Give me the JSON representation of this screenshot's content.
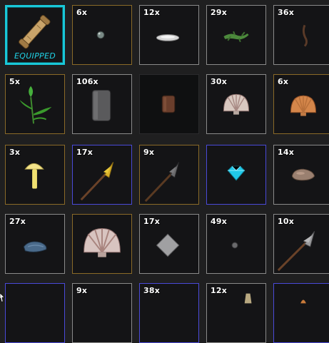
{
  "inventory": {
    "equipped_label": "EQUIPPED",
    "slots": [
      {
        "name": "scroll",
        "count": "",
        "equipped": true
      },
      {
        "name": "pearl",
        "count": "6x"
      },
      {
        "name": "silver-disc",
        "count": "12x"
      },
      {
        "name": "green-lizard",
        "count": "29x"
      },
      {
        "name": "twig",
        "count": "36x"
      },
      {
        "name": "green-plant",
        "count": "5x"
      },
      {
        "name": "grey-canister",
        "count": "106x"
      },
      {
        "name": "copper-canister",
        "count": ""
      },
      {
        "name": "scallop-shell-white",
        "count": "30x"
      },
      {
        "name": "scallop-shell-orange",
        "count": "6x"
      },
      {
        "name": "yellow-mushroom",
        "count": "3x"
      },
      {
        "name": "golden-spear",
        "count": "17x"
      },
      {
        "name": "iron-spear",
        "count": "9x"
      },
      {
        "name": "cyan-gem",
        "count": ""
      },
      {
        "name": "brown-stone",
        "count": "14x"
      },
      {
        "name": "blue-mussel",
        "count": "27x"
      },
      {
        "name": "large-scallop-shell",
        "count": ""
      },
      {
        "name": "grey-diamond-tile",
        "count": "17x"
      },
      {
        "name": "small-grey-pebble",
        "count": "49x"
      },
      {
        "name": "silver-spear",
        "count": "10x"
      },
      {
        "name": "partial-slot",
        "count": ""
      },
      {
        "name": "partial-slot",
        "count": "9x"
      },
      {
        "name": "partial-slot",
        "count": "38x"
      },
      {
        "name": "partial-slot",
        "count": "12x"
      },
      {
        "name": "partial-slot",
        "count": ""
      }
    ]
  }
}
